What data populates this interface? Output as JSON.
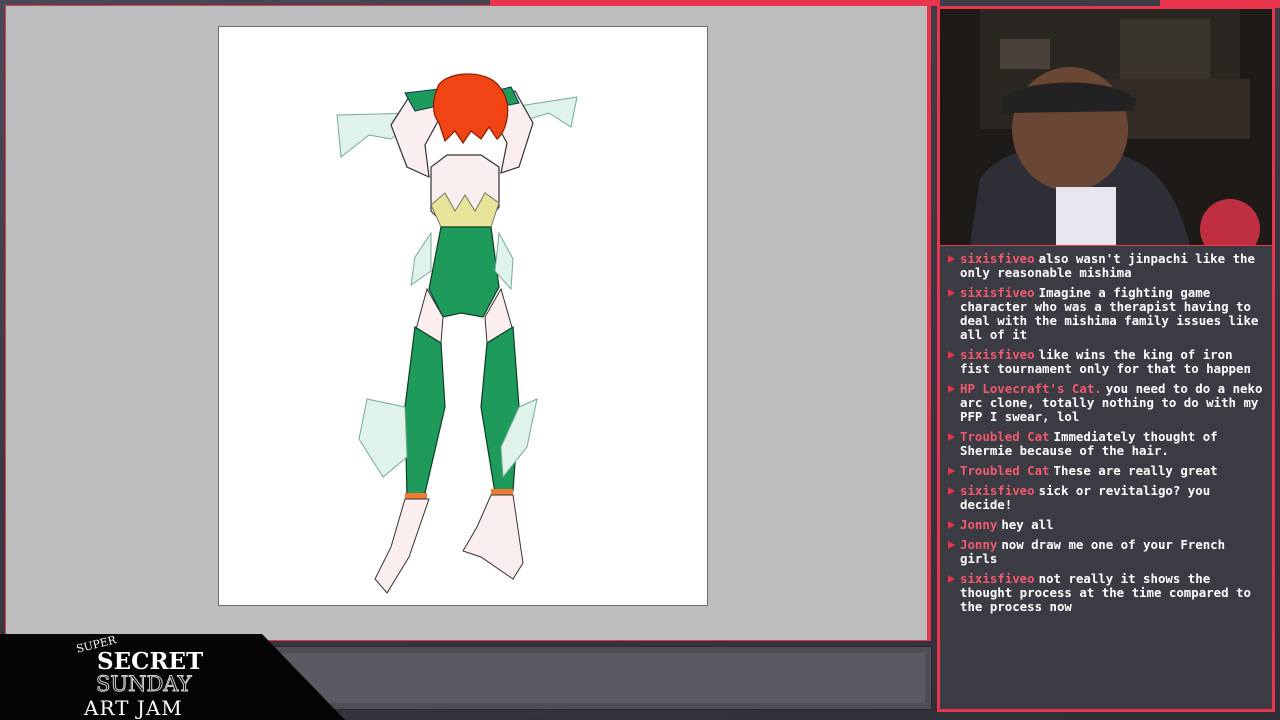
{
  "logo": {
    "line1": "SUPER",
    "line2": "SECRET",
    "line3": "SUNDAY",
    "line4": "ART JAM"
  },
  "chat": {
    "messages": [
      {
        "user": "sixisfiveo",
        "text": "also wasn't jinpachi like the only reasonable mishima"
      },
      {
        "user": "sixisfiveo",
        "text": "Imagine a fighting game character who was a therapist having to deal with the mishima family issues like all of it"
      },
      {
        "user": "sixisfiveo",
        "text": "like wins the king of iron fist tournament only for that to happen"
      },
      {
        "user": "HP Lovecraft's Cat.",
        "text": "you need to do a neko arc clone, totally nothing to do with my PFP I swear, lol"
      },
      {
        "user": "Troubled Cat",
        "text": "Immediately thought of Shermie because of the hair."
      },
      {
        "user": "Troubled Cat",
        "text": "These are really great"
      },
      {
        "user": "sixisfiveo",
        "text": "sick or revitaligo? you decide!"
      },
      {
        "user": "Jonny",
        "text": "hey all"
      },
      {
        "user": "Jonny",
        "text": "now draw me one of your French girls"
      },
      {
        "user": "sixisfiveo",
        "text": "not really it shows the thought process at the time compared to the process now"
      }
    ]
  },
  "colors": {
    "accent": "#e8344c",
    "username": "#f05a6e",
    "chat_bg": "#3b3b43",
    "canvas_bg": "#bdbdbd",
    "suit": "#1e9a5a",
    "hair": "#f04414",
    "fins": "#d9f2e6"
  }
}
